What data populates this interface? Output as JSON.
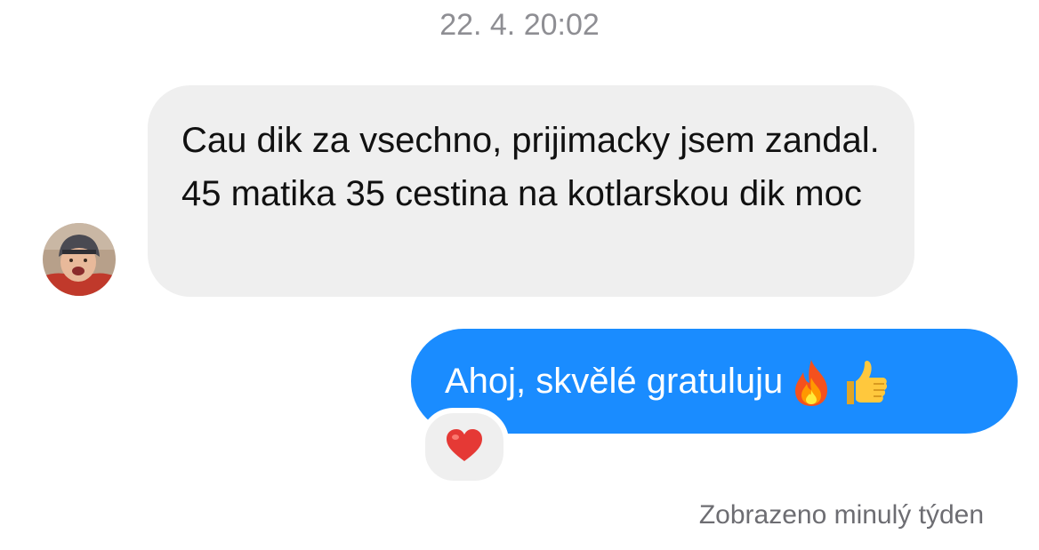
{
  "conversation": {
    "timestamp": "22. 4. 20:02",
    "incoming": {
      "text": "Cau dik za vsechno, prijimacky jsem zandal. 45 matika 35 cestina na kotlarskou dik moc",
      "sender_avatar": "avatar-photo"
    },
    "outgoing": {
      "text": "Ahoj, skvělé gratuluju",
      "emojis": [
        "fire-emoji",
        "thumbs-up-emoji"
      ],
      "reaction": "red-heart-emoji",
      "bubble_color": "#1a8cff"
    },
    "seen_status": "Zobrazeno minulý týden"
  },
  "colors": {
    "incoming_bubble": "#efefef",
    "outgoing_bubble": "#1a8cff",
    "meta_text": "#8e8e93"
  }
}
